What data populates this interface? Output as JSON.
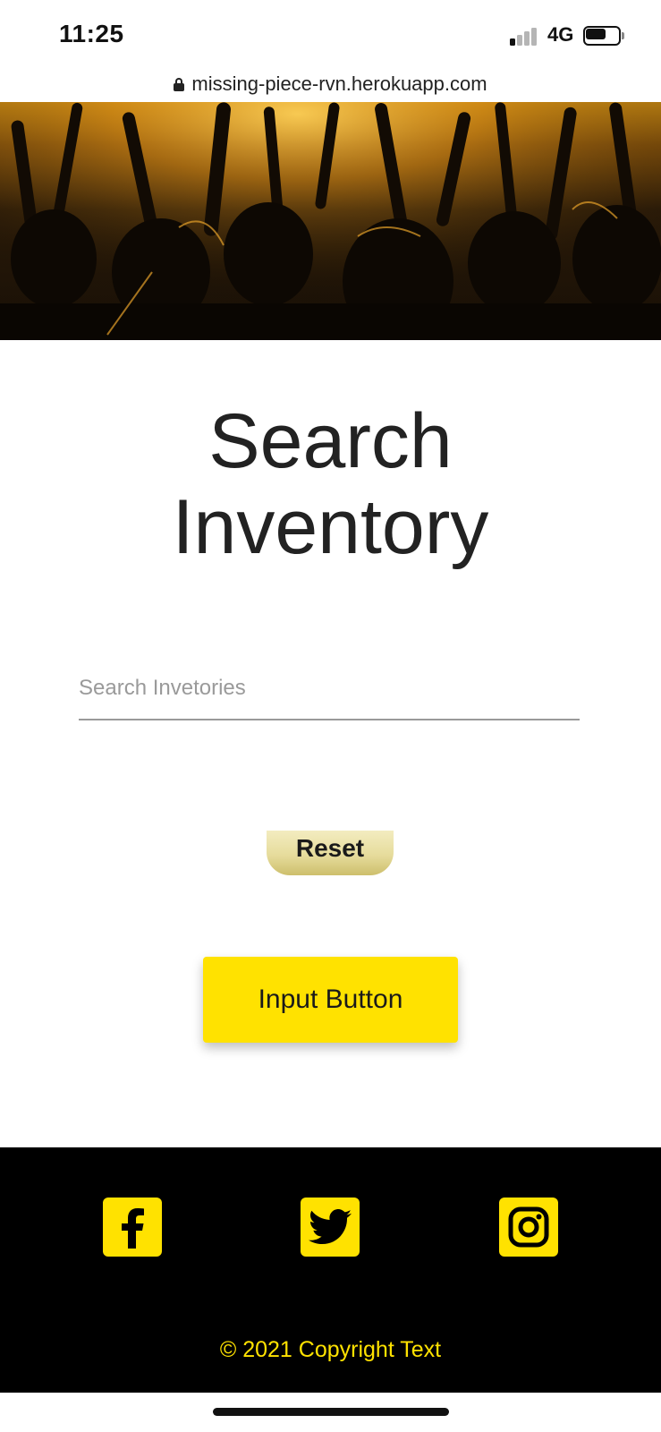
{
  "status_bar": {
    "time": "11:25",
    "network": "4G"
  },
  "browser": {
    "url": "missing-piece-rvn.herokuapp.com"
  },
  "page": {
    "title_line1": "Search",
    "title_line2": "Inventory",
    "search_placeholder": "Search Invetories",
    "reset_label": "Reset",
    "input_button_label": "Input Button"
  },
  "footer": {
    "social_icons": [
      "facebook-icon",
      "twitter-icon",
      "instagram-icon"
    ],
    "copyright": "© 2021 Copyright Text"
  },
  "colors": {
    "accent_yellow": "#ffe200",
    "footer_bg": "#000000",
    "text_dark": "#222222"
  }
}
